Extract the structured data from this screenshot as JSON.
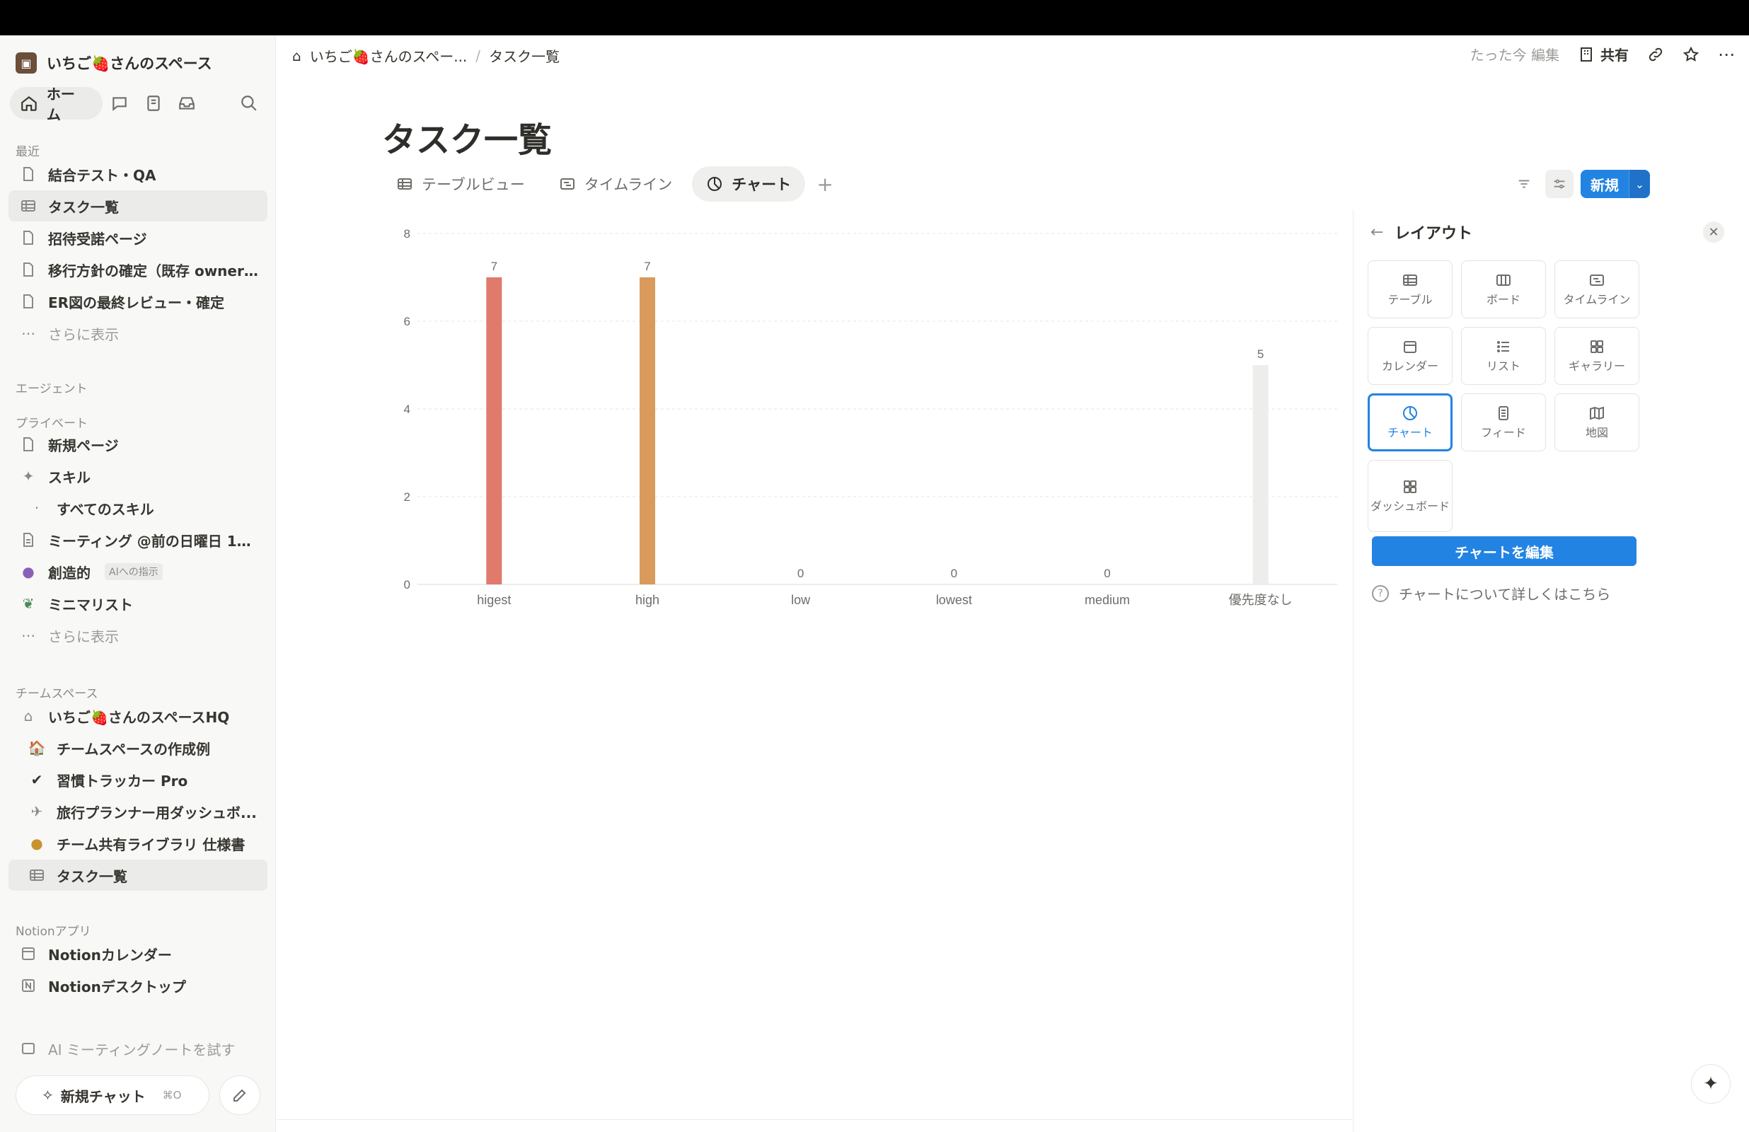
{
  "workspace": {
    "name": "いちご🍓さんのスペース"
  },
  "nav": {
    "home_label": "ホーム"
  },
  "sidebar": {
    "recent_label": "最近",
    "recent": [
      {
        "label": "結合テスト・QA"
      },
      {
        "label": "タスク一覧"
      },
      {
        "label": "招待受諾ページ"
      },
      {
        "label": "移行方針の確定（既存 owner ..."
      },
      {
        "label": "ER図の最終レビュー・確定"
      }
    ],
    "more_label": "さらに表示",
    "agents_label": "エージェント",
    "private_label": "プライベート",
    "private": [
      {
        "label": "新規ページ"
      },
      {
        "label": "スキル"
      },
      {
        "label": "すべてのスキル"
      },
      {
        "label": "ミーティング @前の日曜日 15:..."
      },
      {
        "label": "創造的",
        "badge": "AIへの指示"
      },
      {
        "label": "ミニマリスト"
      }
    ],
    "teamspace_label": "チームスペース",
    "teamspace": [
      {
        "label": "いちご🍓さんのスペースHQ"
      },
      {
        "label": "チームスペースの作成例"
      },
      {
        "label": "習慣トラッカー Pro"
      },
      {
        "label": "旅行プランナー用ダッシュボ..."
      },
      {
        "label": "チーム共有ライブラリ 仕様書"
      },
      {
        "label": "タスク一覧"
      }
    ],
    "apps_label": "Notionアプリ",
    "apps": [
      {
        "label": "Notionカレンダー"
      },
      {
        "label": "Notionデスクトップ"
      }
    ],
    "ai_meeting": "AI ミーティングノートを試す",
    "new_chat": "新規チャット",
    "new_chat_kbd": "⌘O"
  },
  "header": {
    "breadcrumb": [
      "いちご🍓さんのスペー...",
      "タスク一覧"
    ],
    "edited": "たった今 編集",
    "share": "共有"
  },
  "page": {
    "title": "タスク一覧",
    "tabs": [
      {
        "label": "テーブルビュー"
      },
      {
        "label": "タイムライン"
      },
      {
        "label": "チャート"
      }
    ],
    "new_label": "新規"
  },
  "chart_data": {
    "type": "bar",
    "categories": [
      "higest",
      "high",
      "low",
      "lowest",
      "medium",
      "優先度なし"
    ],
    "values": [
      7,
      7,
      0,
      0,
      0,
      5
    ],
    "colors": [
      "#e07a6c",
      "#d99a5c",
      "#e0e0de",
      "#e0e0de",
      "#e0e0de",
      "#ededeb"
    ],
    "yticks": [
      0,
      2,
      4,
      6,
      8
    ],
    "ylim": [
      0,
      8
    ],
    "grid": true
  },
  "layout_panel": {
    "title": "レイアウト",
    "options": [
      {
        "label": "テーブル",
        "icon": "table-icon"
      },
      {
        "label": "ボード",
        "icon": "board-icon"
      },
      {
        "label": "タイムライン",
        "icon": "timeline-icon"
      },
      {
        "label": "カレンダー",
        "icon": "calendar-icon"
      },
      {
        "label": "リスト",
        "icon": "list-icon"
      },
      {
        "label": "ギャラリー",
        "icon": "gallery-icon"
      },
      {
        "label": "チャート",
        "icon": "chart-icon",
        "active": true
      },
      {
        "label": "フィード",
        "icon": "feed-icon"
      },
      {
        "label": "地図",
        "icon": "map-icon"
      },
      {
        "label": "ダッシュボード",
        "icon": "dashboard-icon"
      }
    ],
    "edit_chart": "チャートを編集",
    "learn_more": "チャートについて詳しくはこちら"
  }
}
